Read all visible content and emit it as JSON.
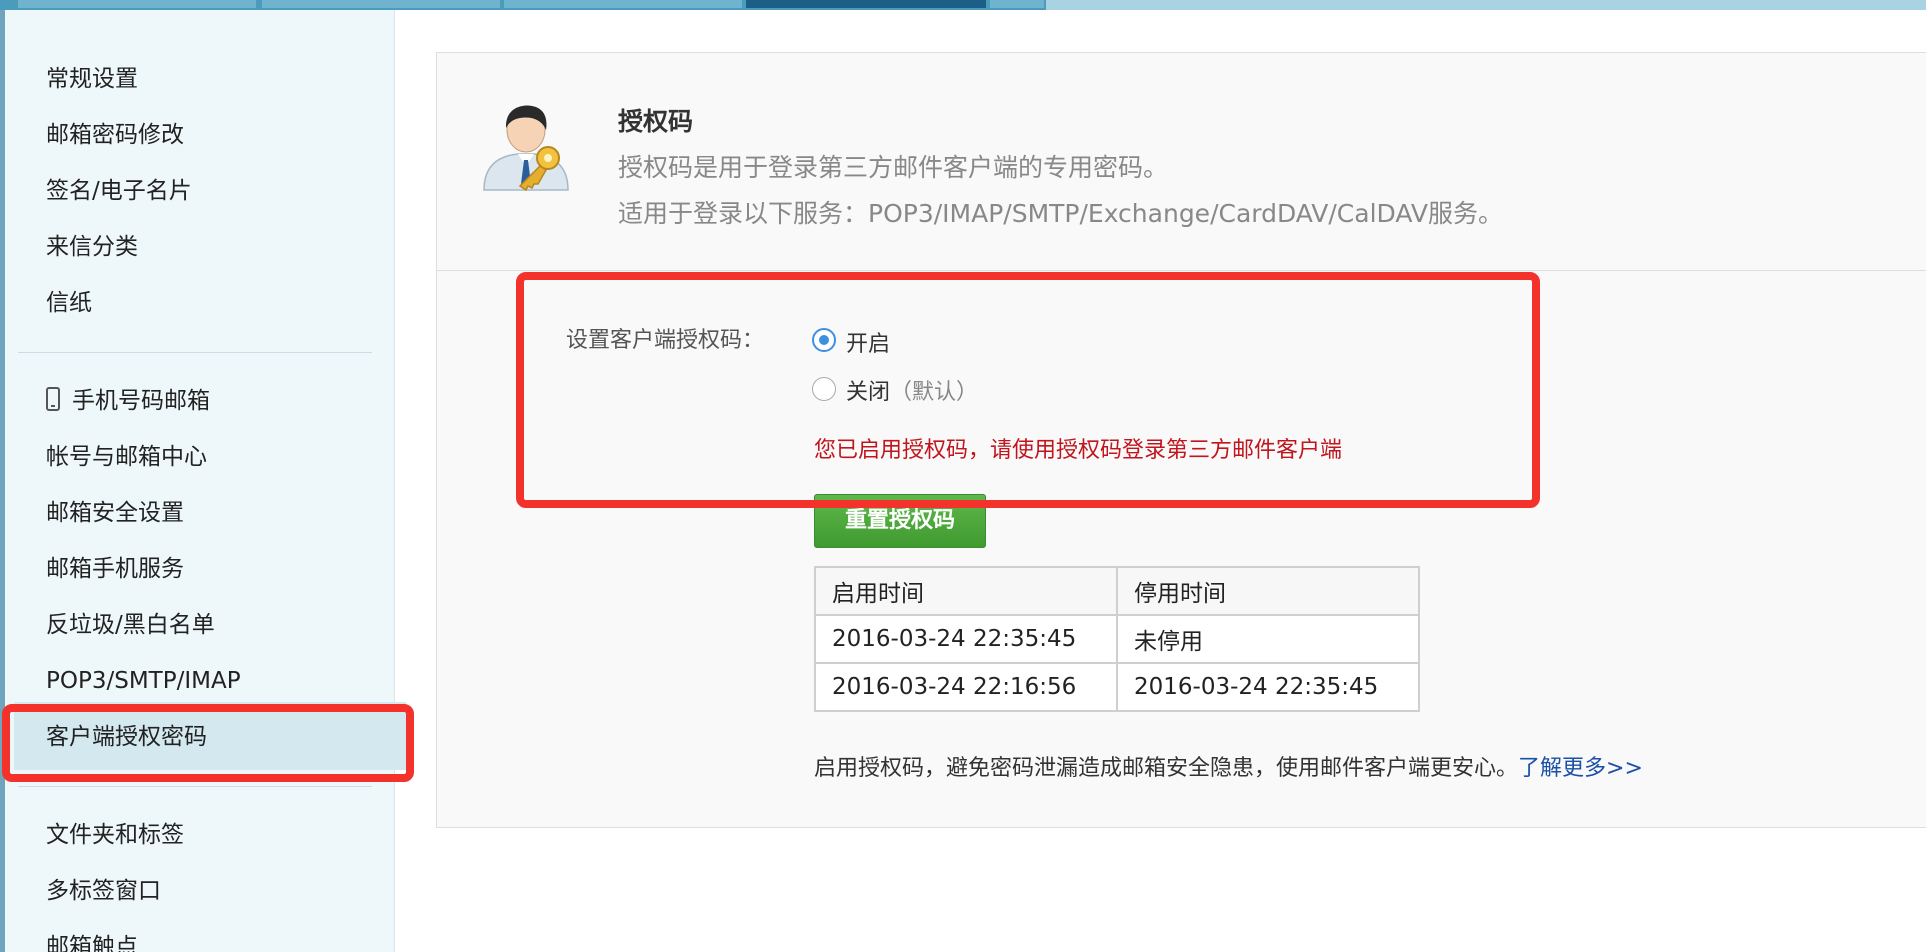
{
  "sidebar": {
    "items": [
      {
        "label": "常规设置"
      },
      {
        "label": "邮箱密码修改"
      },
      {
        "label": "签名/电子名片"
      },
      {
        "label": "来信分类"
      },
      {
        "label": "信纸"
      },
      {
        "label": "手机号码邮箱"
      },
      {
        "label": "帐号与邮箱中心"
      },
      {
        "label": "邮箱安全设置"
      },
      {
        "label": "邮箱手机服务"
      },
      {
        "label": "反垃圾/黑白名单"
      },
      {
        "label": "POP3/SMTP/IMAP"
      },
      {
        "label": "客户端授权密码"
      },
      {
        "label": "文件夹和标签"
      },
      {
        "label": "多标签窗口"
      },
      {
        "label": "邮箱触点"
      }
    ]
  },
  "main": {
    "title": "授权码",
    "desc_line1": "授权码是用于登录第三方邮件客户端的专用密码。",
    "desc_line2": "适用于登录以下服务：POP3/IMAP/SMTP/Exchange/CardDAV/CalDAV服务。",
    "setting_label": "设置客户端授权码：",
    "option_on": "开启",
    "option_off": "关闭",
    "option_off_hint": "（默认）",
    "status_message": "您已启用授权码，请使用授权码登录第三方邮件客户端",
    "reset_button": "重置授权码",
    "table": {
      "headers": [
        "启用时间",
        "停用时间"
      ],
      "rows": [
        [
          "2016-03-24 22:35:45",
          "未停用"
        ],
        [
          "2016-03-24 22:16:56",
          "2016-03-24 22:35:45"
        ]
      ]
    },
    "footer_text": "启用授权码，避免密码泄漏造成邮箱安全隐患，使用邮件客户端更安心。",
    "learn_more": "了解更多>>"
  },
  "colors": {
    "highlight": "#f2322b",
    "status_text": "#c0151c",
    "button_green": "#4caa3a",
    "link": "#1a50a8"
  }
}
